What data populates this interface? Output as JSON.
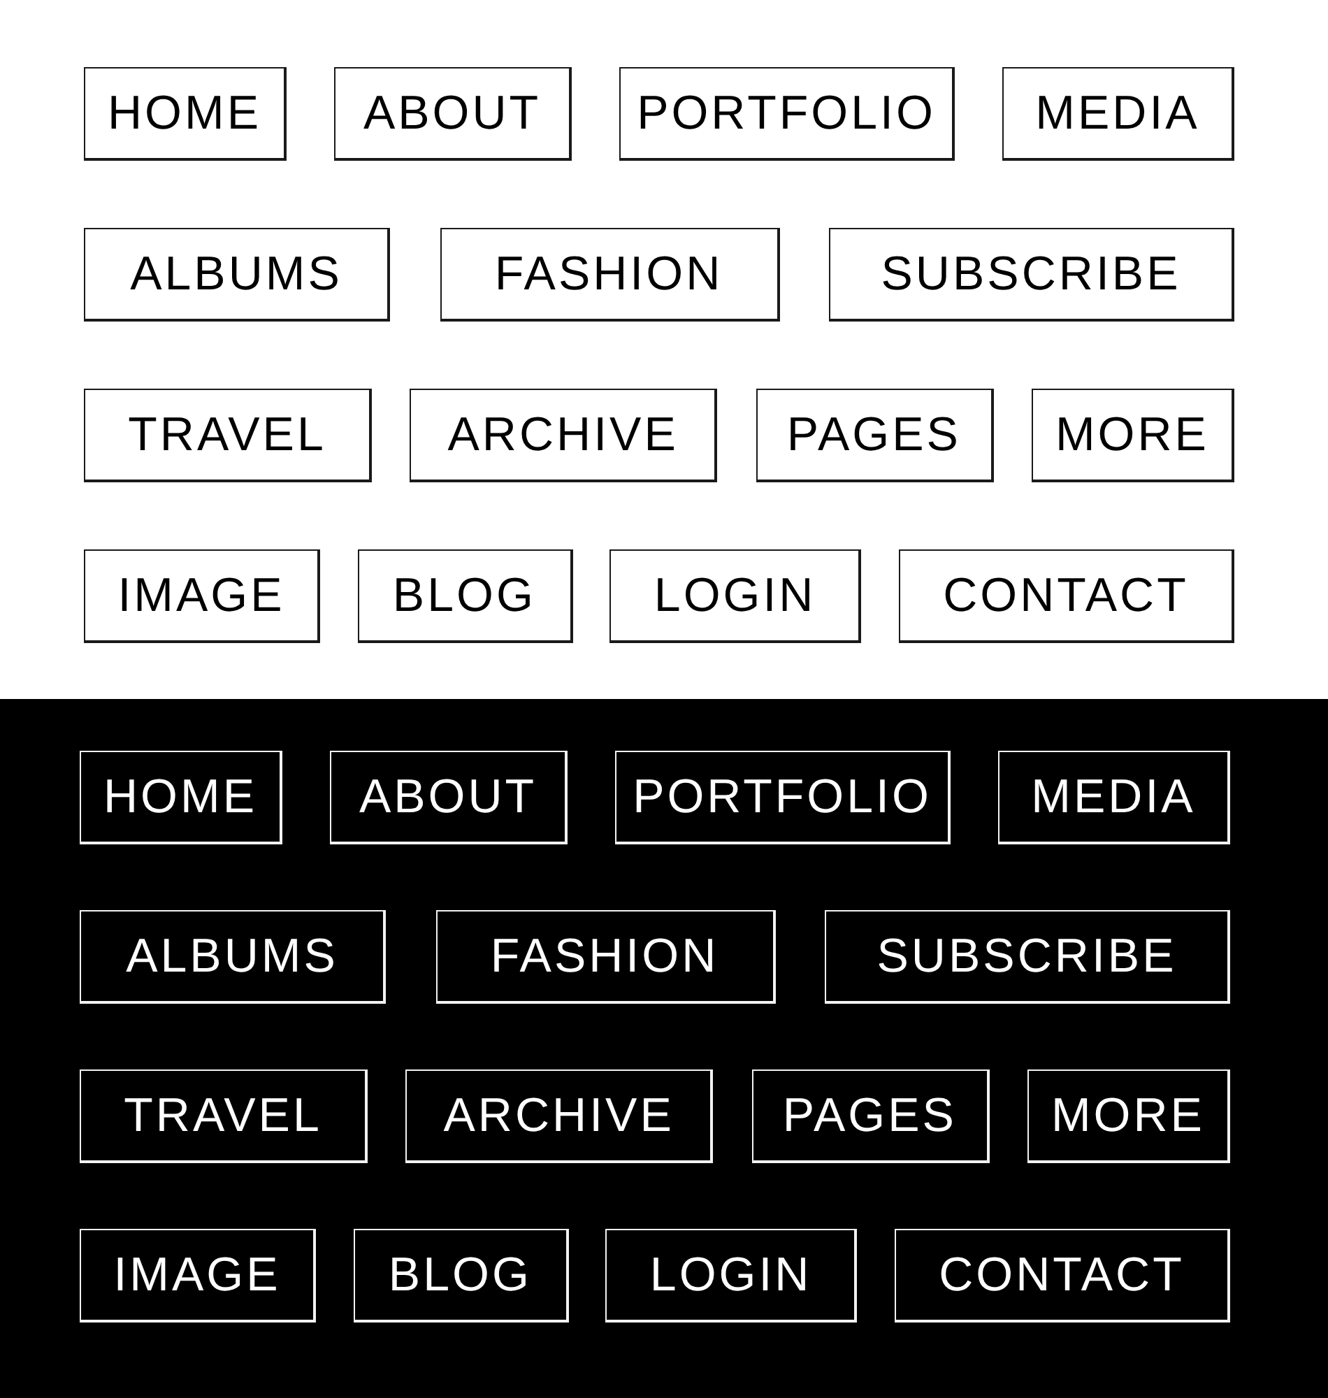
{
  "panels": [
    {
      "dark": false,
      "rows": [
        {
          "buttons": [
            "HOME",
            "ABOUT",
            "PORTFOLIO",
            "MEDIA"
          ]
        },
        {
          "buttons": [
            "ALBUMS",
            "FASHION",
            "SUBSCRIBE"
          ]
        },
        {
          "buttons": [
            "TRAVEL",
            "ARCHIVE",
            "PAGES",
            "MORE"
          ]
        },
        {
          "buttons": [
            "IMAGE",
            "BLOG",
            "LOGIN",
            "CONTACT"
          ]
        }
      ]
    },
    {
      "dark": true,
      "rows": [
        {
          "buttons": [
            "HOME",
            "ABOUT",
            "PORTFOLIO",
            "MEDIA"
          ]
        },
        {
          "buttons": [
            "ALBUMS",
            "FASHION",
            "SUBSCRIBE"
          ]
        },
        {
          "buttons": [
            "TRAVEL",
            "ARCHIVE",
            "PAGES",
            "MORE"
          ]
        },
        {
          "buttons": [
            "IMAGE",
            "BLOG",
            "LOGIN",
            "CONTACT"
          ]
        }
      ]
    }
  ]
}
